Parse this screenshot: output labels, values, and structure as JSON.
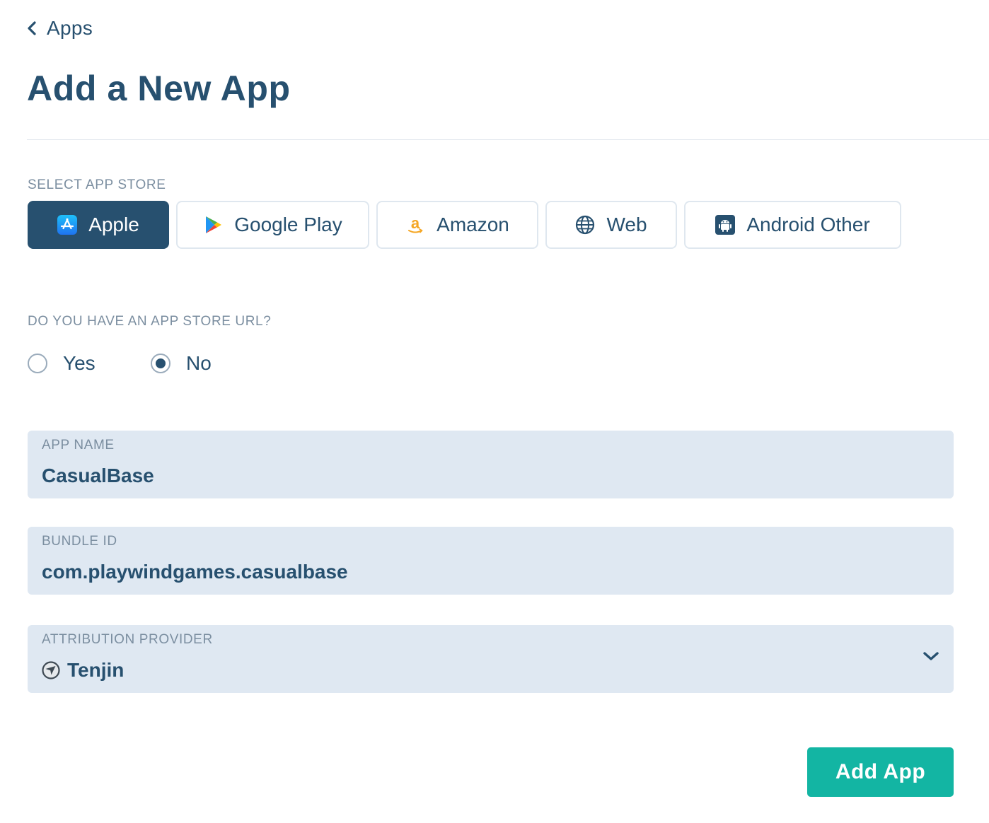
{
  "nav": {
    "back_label": "Apps"
  },
  "page": {
    "title": "Add a New App"
  },
  "store_select": {
    "label": "SELECT APP STORE",
    "selected": "Apple",
    "options": [
      {
        "label": "Apple",
        "icon": "app-store-icon",
        "selected": true
      },
      {
        "label": "Google Play",
        "icon": "google-play-icon",
        "selected": false
      },
      {
        "label": "Amazon",
        "icon": "amazon-icon",
        "selected": false
      },
      {
        "label": "Web",
        "icon": "globe-icon",
        "selected": false
      },
      {
        "label": "Android Other",
        "icon": "android-icon",
        "selected": false
      }
    ]
  },
  "url_question": {
    "label": "DO YOU HAVE AN APP STORE URL?",
    "options": [
      {
        "label": "Yes",
        "checked": false
      },
      {
        "label": "No",
        "checked": true
      }
    ]
  },
  "form": {
    "app_name": {
      "label": "APP NAME",
      "value": "CasualBase"
    },
    "bundle_id": {
      "label": "BUNDLE ID",
      "value": "com.playwindgames.casualbase"
    },
    "attribution": {
      "label": "ATTRIBUTION PROVIDER",
      "value": "Tenjin",
      "icon": "tenjin-logo-icon"
    }
  },
  "submit": {
    "label": "Add App"
  },
  "colors": {
    "primary": "#27506f",
    "accent": "#13b5a3",
    "field_bg": "#dfe8f2",
    "muted_label": "#7b8ea0"
  }
}
